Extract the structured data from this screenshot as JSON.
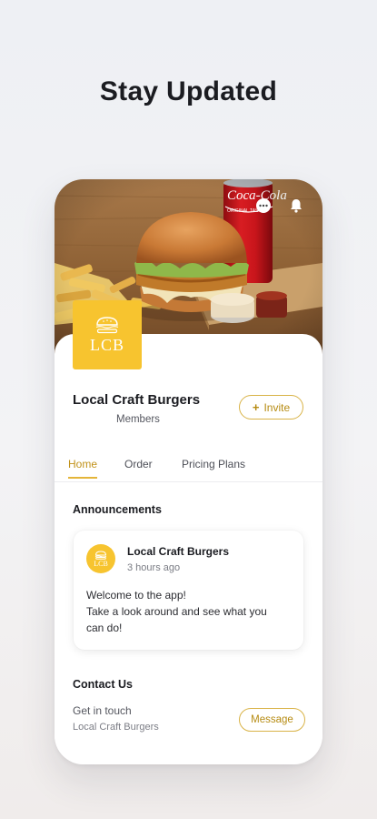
{
  "headline": "Stay Updated",
  "header_icons": [
    "more-icon",
    "bell-icon"
  ],
  "business": {
    "logo_text": "LCB",
    "name": "Local Craft Burgers",
    "members_label": "Members",
    "invite_label": "Invite"
  },
  "tabs": [
    {
      "label": "Home",
      "active": true
    },
    {
      "label": "Order",
      "active": false
    },
    {
      "label": "Pricing Plans",
      "active": false
    }
  ],
  "announcements": {
    "section_title": "Announcements",
    "post": {
      "avatar_text": "LCB",
      "author": "Local Craft Burgers",
      "time": "3 hours ago",
      "lines": [
        "Welcome to the app!",
        "Take a look around and see what you",
        "can do!"
      ]
    }
  },
  "contact": {
    "section_title": "Contact Us",
    "get_in_touch": "Get in touch",
    "business_name": "Local Craft Burgers",
    "message_label": "Message"
  },
  "colors": {
    "brand_yellow": "#f7c42f",
    "accent_gold": "#c1921a",
    "button_border": "#d9b347"
  }
}
